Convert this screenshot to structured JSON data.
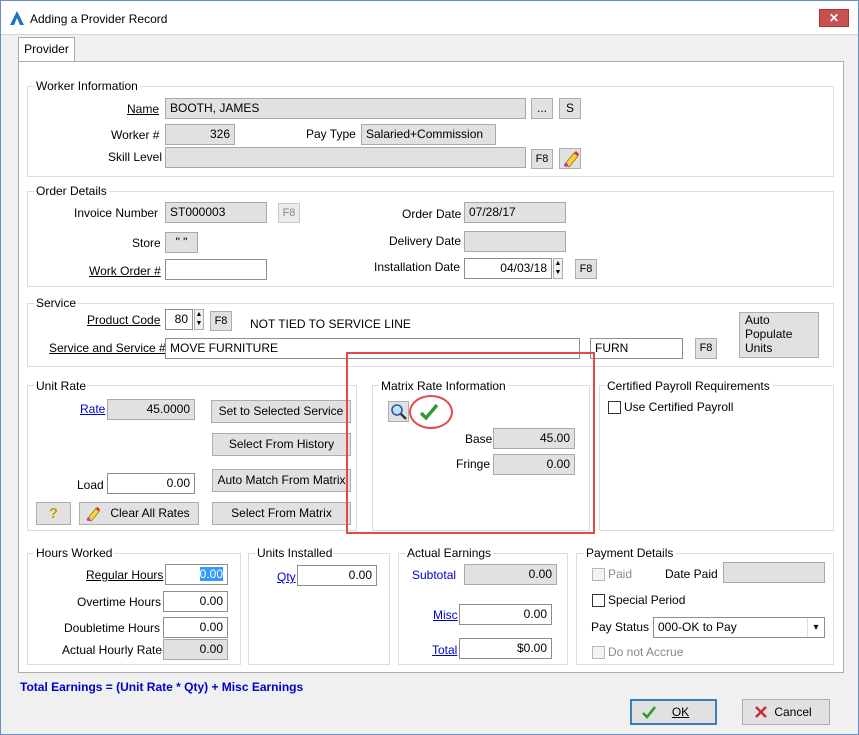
{
  "window": {
    "title": "Adding a Provider Record",
    "close_glyph": "✕"
  },
  "tabs": [
    {
      "label": "Provider"
    }
  ],
  "worker_info": {
    "title": "Worker Information",
    "name_label": "Name",
    "name_value": "BOOTH, JAMES",
    "browse_btn": "...",
    "s_btn": "S",
    "worker_no_label": "Worker #",
    "worker_no_value": "326",
    "pay_type_label": "Pay Type",
    "pay_type_value": "Salaried+Commission",
    "skill_level_label": "Skill Level",
    "skill_level_value": "",
    "f8_btn": "F8"
  },
  "order_details": {
    "title": "Order Details",
    "invoice_label": "Invoice Number",
    "invoice_value": "ST000003",
    "invoice_f8": "F8",
    "store_label": "Store",
    "store_value": "\" \"",
    "work_order_label": "Work Order #",
    "work_order_value": "",
    "order_date_label": "Order Date",
    "order_date_value": "07/28/17",
    "delivery_date_label": "Delivery Date",
    "delivery_date_value": "",
    "install_date_label": "Installation Date",
    "install_date_value": "04/03/18",
    "install_f8": "F8"
  },
  "service": {
    "title": "Service",
    "product_code_label": "Product Code",
    "product_code_value": "80",
    "product_f8": "F8",
    "not_tied_text": "NOT TIED TO SERVICE LINE",
    "service_label": "Service and Service #",
    "service_value": "MOVE FURNITURE",
    "service_code_value": "FURN",
    "service_f8": "F8",
    "auto_populate_btn": [
      "Auto",
      "Populate",
      "Units"
    ]
  },
  "unit_rate": {
    "title": "Unit Rate",
    "rate_label": "Rate",
    "rate_value": "45.0000",
    "set_selected_btn": "Set to Selected Service",
    "select_history_btn": "Select From History",
    "auto_match_btn": "Auto Match From Matrix",
    "load_label": "Load",
    "load_value": "0.00",
    "help_glyph": "?",
    "clear_rates_btn": "Clear All Rates",
    "select_matrix_btn": "Select From Matrix"
  },
  "matrix_rate": {
    "title": "Matrix Rate Information",
    "base_label": "Base",
    "base_value": "45.00",
    "fringe_label": "Fringe",
    "fringe_value": "0.00"
  },
  "certified_payroll": {
    "title": "Certified Payroll Requirements",
    "use_certified_label": "Use Certified Payroll"
  },
  "hours_worked": {
    "title": "Hours Worked",
    "regular_label": "Regular Hours",
    "regular_value": "0.00",
    "overtime_label": "Overtime Hours",
    "overtime_value": "0.00",
    "doubletime_label": "Doubletime Hours",
    "doubletime_value": "0.00",
    "actual_rate_label": "Actual Hourly Rate",
    "actual_rate_value": "0.00"
  },
  "units_installed": {
    "title": "Units Installed",
    "qty_label": "Qty",
    "qty_value": "0.00"
  },
  "actual_earnings": {
    "title": "Actual Earnings",
    "subtotal_label": "Subtotal",
    "subtotal_value": "0.00",
    "misc_label": "Misc",
    "misc_value": "0.00",
    "total_label": "Total",
    "total_value": "$0.00"
  },
  "payment_details": {
    "title": "Payment Details",
    "paid_label": "Paid",
    "date_paid_label": "Date Paid",
    "date_paid_value": "",
    "special_period_label": "Special Period",
    "pay_status_label": "Pay Status",
    "pay_status_value": "000-OK to Pay",
    "do_not_accrue_label": "Do not Accrue"
  },
  "formula_text": "Total Earnings = (Unit Rate * Qty) + Misc Earnings",
  "footer": {
    "ok_label": "OK",
    "cancel_label": "Cancel"
  },
  "colors": {
    "link": "#0000cc",
    "highlight": "#e04a4a",
    "selection": "#3399ff"
  }
}
